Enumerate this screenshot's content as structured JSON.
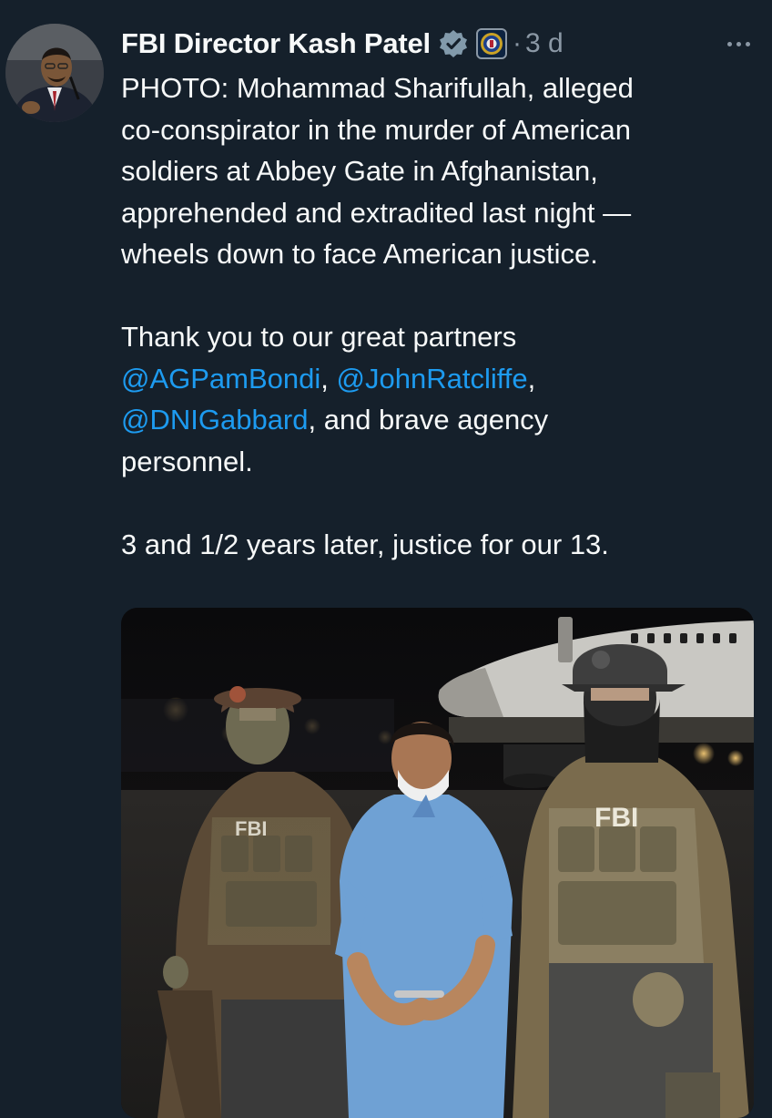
{
  "tweet": {
    "author_name": "FBI Director Kash Patel",
    "separator": "·",
    "time": "3 d",
    "text": {
      "line1": "PHOTO: Mohammad Sharifullah, alleged",
      "line2": "co-conspirator in the murder of American",
      "line3": "soldiers at Abbey Gate in Afghanistan,",
      "line4": "apprehended and extradited last night —",
      "line5": "wheels down to face American justice.",
      "thanks_prefix": "Thank you to our great partners",
      "mention1": "@AGPamBondi",
      "comma1": ", ",
      "mention2": "@JohnRatcliffe",
      "comma2": ",",
      "mention3": "@DNIGabbard",
      "thanks_suffix": ", and brave agency",
      "thanks_end": "personnel.",
      "closing": "3 and 1/2 years later, justice for our 13."
    },
    "photo": {
      "vest_label": "FBI",
      "chest_label": "FBI"
    }
  },
  "icons": {
    "verified": "verified-badge-icon",
    "affiliation": "fbi-seal-icon",
    "more": "more-horizontal-icon"
  },
  "colors": {
    "background": "#15202b",
    "text": "#f7f9f9",
    "secondary": "#8b98a5",
    "link": "#1d9bf0"
  }
}
